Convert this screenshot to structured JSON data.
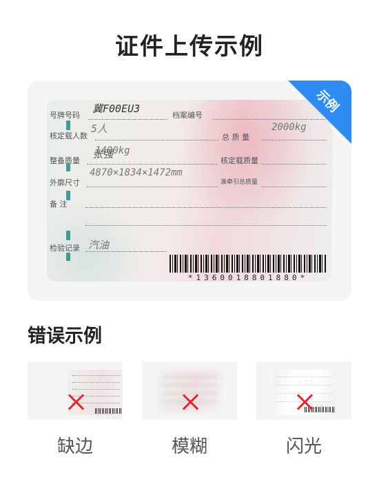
{
  "title": "证件上传示例",
  "example": {
    "badge": "示例",
    "fields": {
      "plate_label": "号牌号码",
      "plate_value": "冀F00EU3",
      "file_label": "档案编号",
      "seats_label": "核定载人数",
      "seats_value": "5人",
      "total_mass_label": "总 质 量",
      "total_mass_value": "2000kg",
      "curb_label": "整备质量",
      "curb_value": "1400kg",
      "curb_overwrite": "张强",
      "load_label": "核定载质量",
      "dims_label": "外廓尺寸",
      "dims_value": "4870×1834×1472mm",
      "tow_label": "准牵引总质量",
      "remark_label": "备 注",
      "inspection_label": "检验记录",
      "fuel_value": "汽油"
    },
    "barcode": "*1360018801880*"
  },
  "errors": {
    "title": "错误示例",
    "items": [
      {
        "label": "缺边"
      },
      {
        "label": "模糊"
      },
      {
        "label": "闪光"
      }
    ]
  },
  "colors": {
    "accent": "#2f8cf5",
    "error_mark": "#e4262d"
  }
}
